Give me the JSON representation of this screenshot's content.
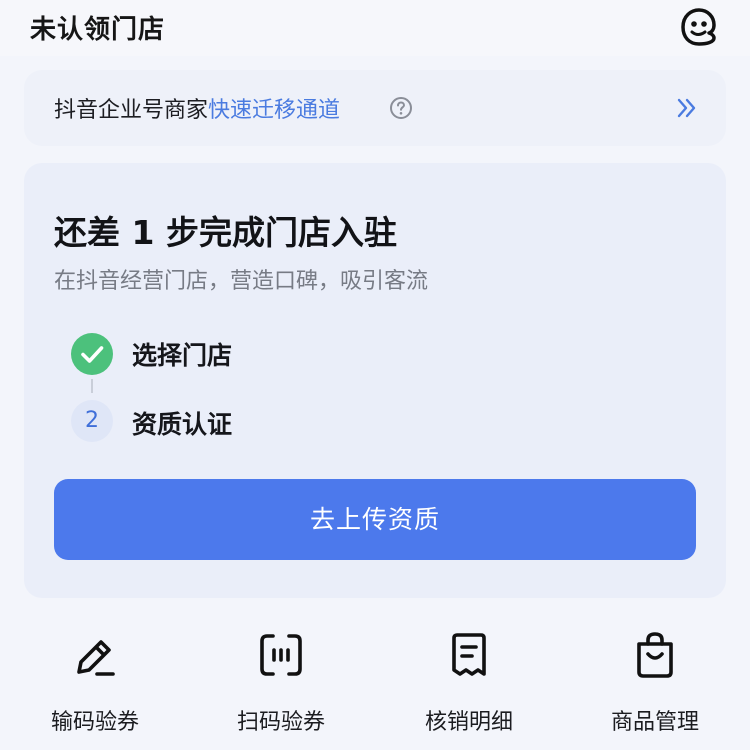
{
  "header": {
    "title": "未认领门店",
    "avatar_icon": "face-icon"
  },
  "banner": {
    "prefix": "抖音企业号商家",
    "link": "快速迁移通道",
    "help_icon": "question-circle-icon",
    "arrow_icon": "double-chevron-right-icon"
  },
  "card": {
    "title": "还差 1 步完成门店入驻",
    "subtitle": "在抖音经营门店，营造口碑，吸引客流",
    "steps": [
      {
        "label": "选择门店",
        "status": "done",
        "icon": "check-circle-icon"
      },
      {
        "label": "资质认证",
        "status": "pending",
        "number": "2"
      }
    ],
    "button_label": "去上传资质"
  },
  "tools": [
    {
      "label": "输码验券",
      "icon": "pencil-icon"
    },
    {
      "label": "扫码验券",
      "icon": "scan-icon"
    },
    {
      "label": "核销明细",
      "icon": "receipt-icon"
    },
    {
      "label": "商品管理",
      "icon": "shopping-bag-icon"
    }
  ],
  "colors": {
    "accent": "#4c79ec",
    "link": "#4a7be0",
    "success": "#4cc17c",
    "background": "#f3f5fb",
    "card": "#eaeef9"
  }
}
